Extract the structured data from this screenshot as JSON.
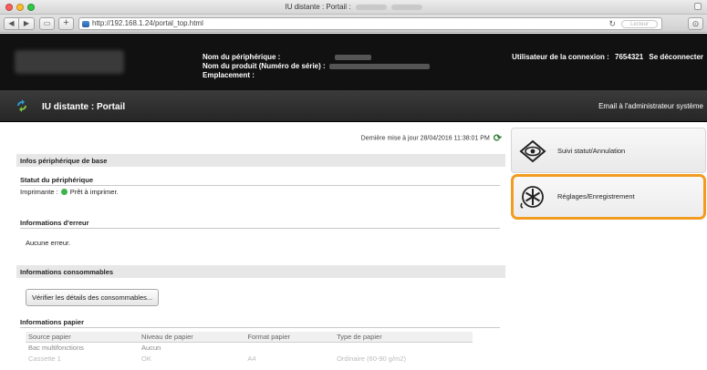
{
  "browser": {
    "window_title": "IU distante : Portail :",
    "url": "http://192.168.1.24/portal_top.html",
    "reader_label": "Lecteur"
  },
  "header": {
    "device_labels": [
      "Nom du périphérique :",
      "Nom du produit (Numéro de série) :",
      "Emplacement :"
    ],
    "user_label": "Utilisateur de la connexion :",
    "user_id": "7654321",
    "logout": "Se déconnecter"
  },
  "subheader": {
    "title": "IU distante : Portail",
    "email_admin": "Email à l'administrateur système"
  },
  "main": {
    "last_update": "Dernière mise à jour 28/04/2016 11:38:01 PM",
    "basic_info_heading": "Infos périphérique de base",
    "device_status_title": "Statut du périphérique",
    "printer_label": "Imprimante :",
    "printer_status": "Prêt à imprimer.",
    "error_info_title": "Informations d'erreur",
    "error_value": "Aucune erreur.",
    "consumables_heading": "Informations consommables",
    "check_button": "Vérifier les détails des consommables...",
    "paper_info_title": "Informations papier",
    "paper_table": {
      "headers": [
        "Source papier",
        "Niveau de papier",
        "Format papier",
        "Type de papier"
      ],
      "rows": [
        [
          "Bac multifonctions",
          "Aucun",
          "",
          ""
        ],
        [
          "Cassette 1",
          "OK",
          "A4",
          "Ordinaire (60-90 g/m2)"
        ]
      ]
    }
  },
  "menu": {
    "status_cancel": "Suivi statut/Annulation",
    "settings": "Réglages/Enregistrement"
  },
  "colors": {
    "accent_orange": "#f29c1f",
    "header_bg": "#111111",
    "ready_green": "#3ab54a"
  }
}
